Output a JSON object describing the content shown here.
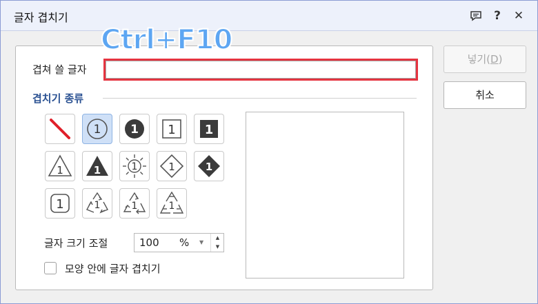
{
  "window": {
    "title": "글자 겹치기",
    "help_label": "?",
    "close_label": "✕",
    "comment_icon": "speech-bubble-icon"
  },
  "overlay_text": "Ctrl+F10",
  "form": {
    "char_label": "겹쳐 쓸 글자",
    "char_value": "",
    "section_title": "겹치기 종류",
    "shapes": [
      {
        "name": "none",
        "icon": "red-slash-icon"
      },
      {
        "name": "circle-outline",
        "icon": "circle-outline-1-icon",
        "selected": true
      },
      {
        "name": "circle-filled",
        "icon": "circle-filled-1-icon"
      },
      {
        "name": "square-outline",
        "icon": "square-outline-1-icon"
      },
      {
        "name": "square-filled",
        "icon": "square-filled-1-icon"
      },
      {
        "name": "triangle-outline",
        "icon": "triangle-outline-1-icon"
      },
      {
        "name": "triangle-filled",
        "icon": "triangle-filled-1-icon"
      },
      {
        "name": "sun",
        "icon": "sun-1-icon"
      },
      {
        "name": "diamond-outline",
        "icon": "diamond-outline-1-icon"
      },
      {
        "name": "diamond-filled",
        "icon": "diamond-filled-1-icon"
      },
      {
        "name": "rounded-square",
        "icon": "rounded-square-1-icon"
      },
      {
        "name": "recycle-1",
        "icon": "recycle-1-icon"
      },
      {
        "name": "recycle-2",
        "icon": "recycle-2-icon"
      },
      {
        "name": "recycle-3",
        "icon": "recycle-3-icon"
      }
    ],
    "glyph": "1",
    "size_label": "글자 크기 조절",
    "size_value": "100",
    "size_unit": "%",
    "checkbox_label": "모양 안에 글자 겹치기",
    "checkbox_checked": false
  },
  "buttons": {
    "insert_label": "넣기(",
    "insert_key": "D",
    "insert_close": ")",
    "cancel_label": "취소"
  },
  "colors": {
    "accent": "#2a5192",
    "highlight": "#e53440",
    "overlay": "#5da6f2",
    "selected": "#cfe0f7"
  }
}
